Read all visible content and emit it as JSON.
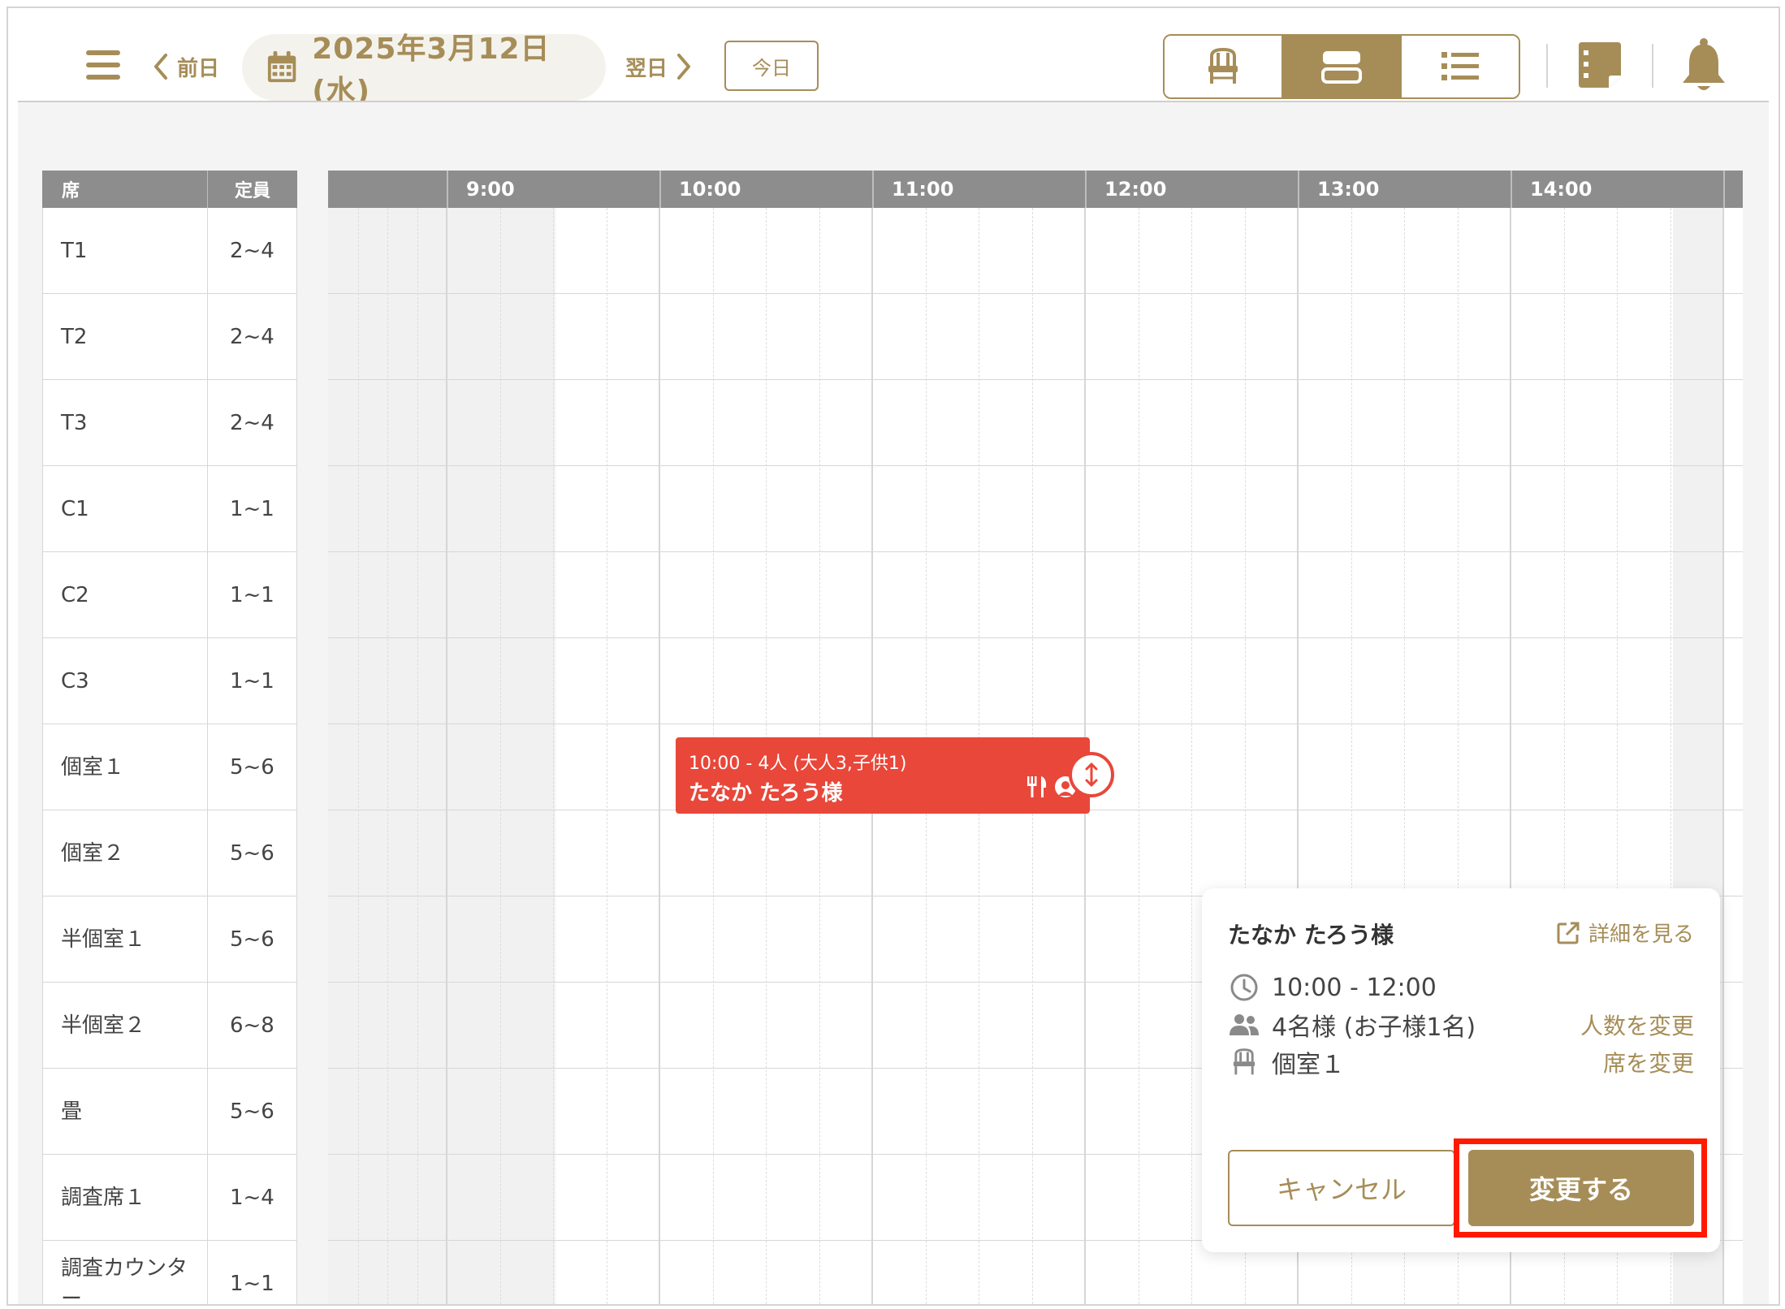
{
  "header": {
    "prev_label": "前日",
    "next_label": "翌日",
    "date": "2025年3月12日 (水)",
    "today_label": "今日",
    "views": [
      {
        "name": "seat-view",
        "icon": "chair-icon",
        "active": false
      },
      {
        "name": "timeline-view",
        "icon": "timeline-icon",
        "active": true
      },
      {
        "name": "list-view",
        "icon": "list-icon",
        "active": false
      }
    ]
  },
  "seat_table": {
    "col_seat": "席",
    "col_capacity": "定員",
    "rows": [
      {
        "name": "T1",
        "capacity": "2~4"
      },
      {
        "name": "T2",
        "capacity": "2~4"
      },
      {
        "name": "T3",
        "capacity": "2~4"
      },
      {
        "name": "C1",
        "capacity": "1~1"
      },
      {
        "name": "C2",
        "capacity": "1~1"
      },
      {
        "name": "C3",
        "capacity": "1~1"
      },
      {
        "name": "個室１",
        "capacity": "5~6"
      },
      {
        "name": "個室２",
        "capacity": "5~6"
      },
      {
        "name": "半個室１",
        "capacity": "5~6"
      },
      {
        "name": "半個室２",
        "capacity": "6~8"
      },
      {
        "name": "畳",
        "capacity": "5~6"
      },
      {
        "name": "調査席１",
        "capacity": "1~4"
      },
      {
        "name": "調査カウンター",
        "capacity": "1~1"
      }
    ]
  },
  "timeline": {
    "hours": [
      "9:00",
      "10:00",
      "11:00",
      "12:00",
      "13:00",
      "14:00"
    ]
  },
  "reservation": {
    "summary": "10:00 - 4人 (大人3,子供1)",
    "guest": "たなか たろう様"
  },
  "popover": {
    "guest": "たなか たろう様",
    "detail_link": "詳細を見る",
    "time": "10:00 - 12:00",
    "party": "4名様 (お子様1名)",
    "party_action": "人数を変更",
    "seat": "個室１",
    "seat_action": "席を変更",
    "cancel_label": "キャンセル",
    "confirm_label": "変更する"
  },
  "colors": {
    "accent": "#a68d58",
    "reservation": "#e8473a",
    "highlight": "#ff1a00"
  }
}
